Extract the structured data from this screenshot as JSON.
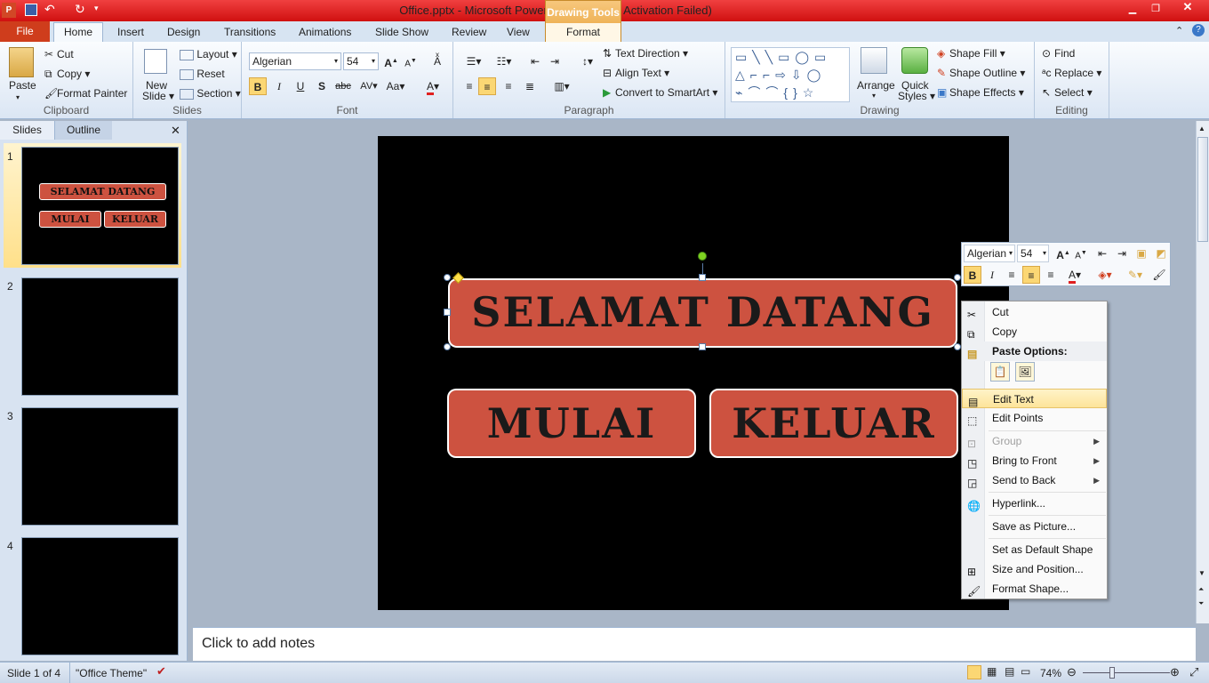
{
  "window": {
    "title": "Office.pptx - Microsoft PowerPoint (Product Activation Failed)",
    "contextual_tab_group": "Drawing Tools"
  },
  "tabs": {
    "file": "File",
    "items": [
      "Home",
      "Insert",
      "Design",
      "Transitions",
      "Animations",
      "Slide Show",
      "Review",
      "View",
      "Format"
    ]
  },
  "ribbon": {
    "clipboard": {
      "paste": "Paste",
      "cut": "Cut",
      "copy": "Copy",
      "format_painter": "Format Painter",
      "label": "Clipboard"
    },
    "slides": {
      "new_slide_1": "New",
      "new_slide_2": "Slide",
      "layout": "Layout",
      "reset": "Reset",
      "section": "Section",
      "label": "Slides"
    },
    "font": {
      "name": "Algerian",
      "size": "54",
      "label": "Font"
    },
    "paragraph": {
      "text_direction": "Text Direction",
      "align_text": "Align Text",
      "convert_smartart": "Convert to SmartArt",
      "label": "Paragraph"
    },
    "drawing": {
      "arrange": "Arrange",
      "quick_styles_1": "Quick",
      "quick_styles_2": "Styles",
      "shape_fill": "Shape Fill",
      "shape_outline": "Shape Outline",
      "shape_effects": "Shape Effects",
      "label": "Drawing"
    },
    "editing": {
      "find": "Find",
      "replace": "Replace",
      "select": "Select",
      "label": "Editing"
    }
  },
  "left_pane": {
    "tab_slides": "Slides",
    "tab_outline": "Outline",
    "thumbs": [
      "1",
      "2",
      "3",
      "4"
    ],
    "thumb1": {
      "title": "SELAMAT DATANG",
      "left": "MULAI",
      "right": "KELUAR"
    }
  },
  "slide": {
    "title_box": "SELAMAT DATANG",
    "left_box": "MULAI",
    "right_box": "KELUAR"
  },
  "notes_placeholder": "Click to add notes",
  "minibar": {
    "font": "Algerian",
    "size": "54"
  },
  "context_menu": {
    "cut": "Cut",
    "copy": "Copy",
    "paste_options": "Paste Options:",
    "edit_text": "Edit Text",
    "edit_points": "Edit Points",
    "group": "Group",
    "bring_to_front": "Bring to Front",
    "send_to_back": "Send to Back",
    "hyperlink": "Hyperlink...",
    "save_as_picture": "Save as Picture...",
    "set_default_shape": "Set as Default Shape",
    "size_position": "Size and Position...",
    "format_shape": "Format Shape..."
  },
  "status": {
    "slide_info": "Slide 1 of 4",
    "theme": "\"Office Theme\"",
    "zoom": "74%"
  },
  "colors": {
    "accent_red": "#cd5240",
    "file_tab": "#cf3d1c",
    "titlebar": "#e02020"
  }
}
